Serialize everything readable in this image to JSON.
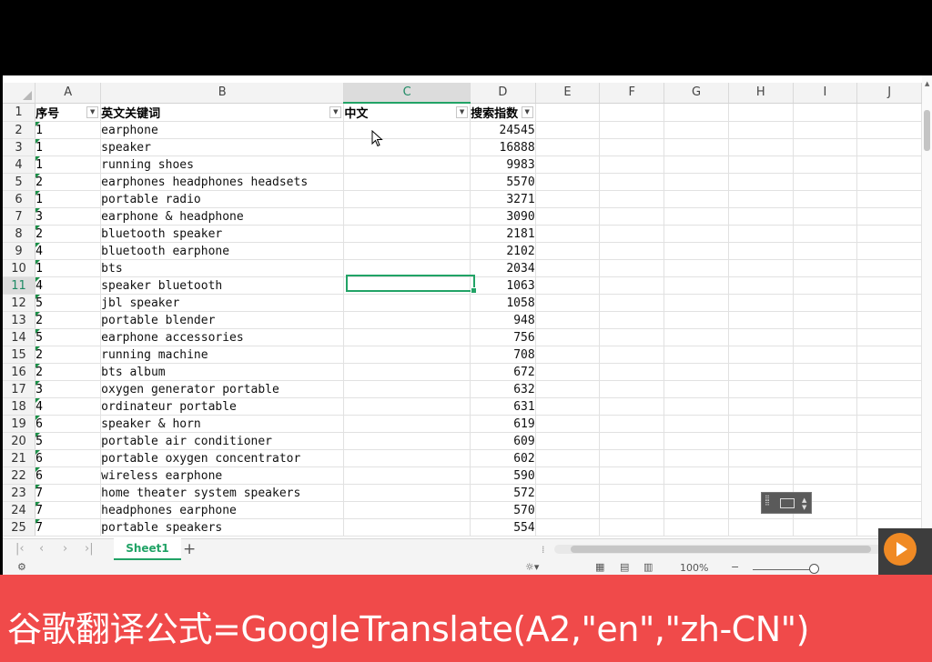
{
  "spreadsheet": {
    "column_headers": [
      "A",
      "B",
      "C",
      "D",
      "E",
      "F",
      "G",
      "H",
      "I",
      "J"
    ],
    "selected_column": "C",
    "selected_row": 11,
    "header_row": {
      "row_number": "1",
      "a": "序号",
      "b": "英文关键词",
      "c": "中文",
      "d": "搜索指数"
    },
    "rows": [
      {
        "n": "2",
        "idx": "1",
        "keyword": "earphone",
        "value": "24545"
      },
      {
        "n": "3",
        "idx": "1",
        "keyword": "speaker",
        "value": "16888"
      },
      {
        "n": "4",
        "idx": "1",
        "keyword": "running shoes",
        "value": "9983"
      },
      {
        "n": "5",
        "idx": "2",
        "keyword": "earphones headphones headsets",
        "value": "5570"
      },
      {
        "n": "6",
        "idx": "1",
        "keyword": "portable radio",
        "value": "3271"
      },
      {
        "n": "7",
        "idx": "3",
        "keyword": "earphone & headphone",
        "value": "3090"
      },
      {
        "n": "8",
        "idx": "2",
        "keyword": "bluetooth speaker",
        "value": "2181"
      },
      {
        "n": "9",
        "idx": "4",
        "keyword": "bluetooth earphone",
        "value": "2102"
      },
      {
        "n": "10",
        "idx": "1",
        "keyword": "bts",
        "value": "2034"
      },
      {
        "n": "11",
        "idx": "4",
        "keyword": "speaker bluetooth",
        "value": "1063"
      },
      {
        "n": "12",
        "idx": "5",
        "keyword": "jbl speaker",
        "value": "1058"
      },
      {
        "n": "13",
        "idx": "2",
        "keyword": "portable blender",
        "value": "948"
      },
      {
        "n": "14",
        "idx": "5",
        "keyword": "earphone accessories",
        "value": "756"
      },
      {
        "n": "15",
        "idx": "2",
        "keyword": "running machine",
        "value": "708"
      },
      {
        "n": "16",
        "idx": "2",
        "keyword": "bts album",
        "value": "672"
      },
      {
        "n": "17",
        "idx": "3",
        "keyword": "oxygen generator portable",
        "value": "632"
      },
      {
        "n": "18",
        "idx": "4",
        "keyword": "ordinateur portable",
        "value": "631"
      },
      {
        "n": "19",
        "idx": "6",
        "keyword": "speaker & horn",
        "value": "619"
      },
      {
        "n": "20",
        "idx": "5",
        "keyword": "portable air conditioner",
        "value": "609"
      },
      {
        "n": "21",
        "idx": "6",
        "keyword": "portable oxygen concentrator",
        "value": "602"
      },
      {
        "n": "22",
        "idx": "6",
        "keyword": "wireless earphone",
        "value": "590"
      },
      {
        "n": "23",
        "idx": "7",
        "keyword": "home theater system speakers",
        "value": "572"
      },
      {
        "n": "24",
        "idx": "7",
        "keyword": "headphones earphone",
        "value": "570"
      },
      {
        "n": "25",
        "idx": "7",
        "keyword": "portable speakers",
        "value": "554"
      }
    ]
  },
  "tabs": {
    "active_sheet": "Sheet1",
    "add_symbol": "+"
  },
  "statusbar": {
    "zoom": "100%"
  },
  "caption": {
    "text": "谷歌翻译公式=GoogleTranslate(A2,\"en\",\"zh-CN\")"
  },
  "colors": {
    "accent": "#21a366",
    "caption_bg": "#f04a4a",
    "backdrop": "#000000"
  },
  "icons": [
    "filter-dropdown-icon",
    "mouse-cursor-icon",
    "keyboard-icon",
    "first-sheet-icon",
    "prev-sheet-icon",
    "next-sheet-icon",
    "last-sheet-icon",
    "add-sheet-icon",
    "normal-view-icon",
    "page-layout-icon",
    "page-break-icon",
    "eye-protection-icon",
    "record-widget-icon"
  ]
}
